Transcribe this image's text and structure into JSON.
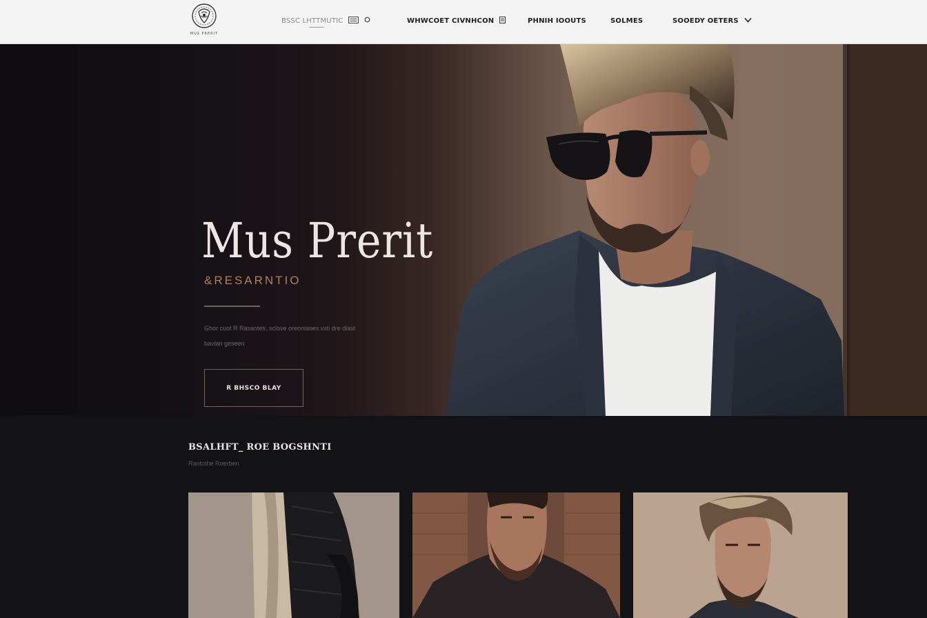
{
  "brand": {
    "logo_text": "MUS PRERIT"
  },
  "nav": {
    "items": [
      {
        "label": "BSSC LHTTMUTIC",
        "icons": [
          "menu-icon",
          "circle-icon"
        ]
      },
      {
        "label": "WHWCOET CIVNHCON",
        "icons": [
          "list-icon"
        ]
      },
      {
        "label": "PHNIH IOOUTS",
        "icons": []
      },
      {
        "label": "SOLMES",
        "icons": []
      },
      {
        "label": "SOOEDY OETERS",
        "icons": [
          "chevron-down-icon"
        ]
      }
    ]
  },
  "hero": {
    "title": "Mus Prerit",
    "subtitle": "&RESARNTIO",
    "description": "Ghor cuot R Rasantes, sclove oreoniases vsti dre dlast bavlan geseen",
    "cta_label": "R BHSCO BLAY"
  },
  "section": {
    "title": "BSALHFT_ ROE BOGSHNTI",
    "subtitle": "Rantothe Roerben"
  },
  "colors": {
    "accent": "#b37e5c",
    "nav_bg": "#f4f4f5",
    "page_bg": "#131217"
  }
}
